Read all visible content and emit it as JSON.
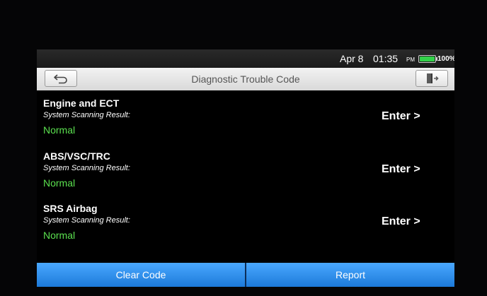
{
  "status_bar": {
    "date": "Apr 8",
    "time": "01:35",
    "ampm": "PM",
    "battery_percent": "100%",
    "battery_level": 1.0,
    "battery_color": "#33d24a"
  },
  "title_bar": {
    "title": "Diagnostic Trouble Code",
    "back_icon": "back-arrow-icon",
    "exit_icon": "exit-door-icon"
  },
  "systems": [
    {
      "name": "Engine and ECT",
      "scan_label": "System Scanning Result:",
      "result": "Normal",
      "enter_label": "Enter >"
    },
    {
      "name": "ABS/VSC/TRC",
      "scan_label": "System Scanning Result:",
      "result": "Normal",
      "enter_label": "Enter >"
    },
    {
      "name": "SRS Airbag",
      "scan_label": "System Scanning Result:",
      "result": "Normal",
      "enter_label": "Enter >"
    }
  ],
  "buttons": {
    "clear_code": "Clear Code",
    "report": "Report"
  },
  "colors": {
    "result_normal": "#5be04f",
    "button_blue": "#2b8ef0"
  }
}
